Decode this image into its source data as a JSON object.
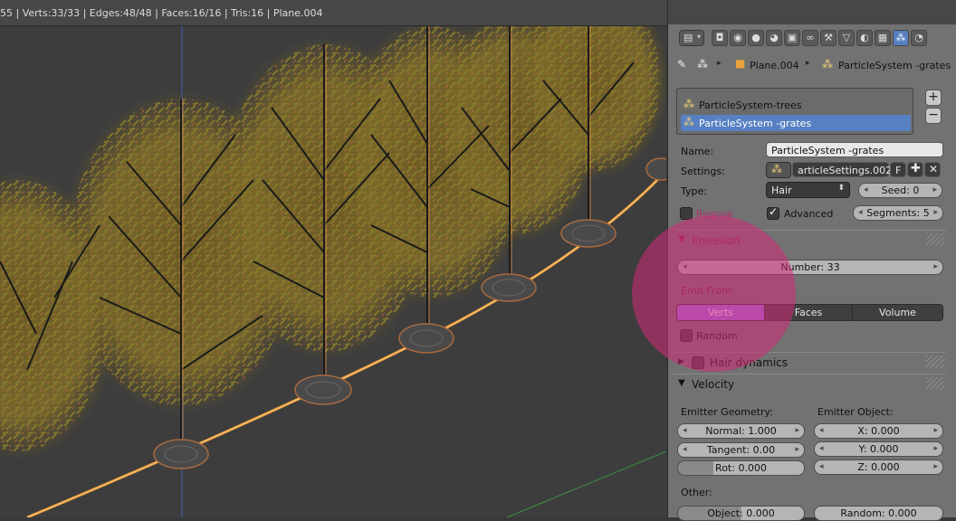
{
  "statusbar": {
    "text": "55 | Verts:33/33 | Edges:48/48 | Faces:16/16 | Tris:16 | Plane.004"
  },
  "properties": {
    "breadcrumb": {
      "object": "Plane.004",
      "particle": "ParticleSystem -grates"
    },
    "toolbar_icons": [
      "render-icon",
      "render-layers-icon",
      "scene-icon",
      "world-icon",
      "object-icon",
      "constraints-icon",
      "modifiers-icon",
      "data-icon",
      "material-icon",
      "texture-icon",
      "particles-icon",
      "physics-icon"
    ],
    "systems": [
      {
        "label": "ParticleSystem-trees",
        "selected": false
      },
      {
        "label": "ParticleSystem -grates",
        "selected": true
      }
    ],
    "name": {
      "label": "Name:",
      "value": "ParticleSystem -grates"
    },
    "settings": {
      "label": "Settings:",
      "value": "articleSettings.002",
      "fake_user": "F"
    },
    "type": {
      "label": "Type:",
      "value": "Hair"
    },
    "seed": {
      "value": "Seed: 0"
    },
    "regrow": {
      "label": "Regrow",
      "checked": false
    },
    "advanced": {
      "label": "Advanced",
      "checked": true
    },
    "segments": {
      "value": "Segments: 5"
    },
    "emission": {
      "title": "Emission",
      "number": "Number: 33",
      "emit_from_label": "Emit From:",
      "options": [
        "Verts",
        "Faces",
        "Volume"
      ],
      "selected": "Verts",
      "random": {
        "label": "Random",
        "checked": false
      }
    },
    "hair_dynamics": {
      "title": "Hair dynamics"
    },
    "velocity": {
      "title": "Velocity",
      "emitter_geometry_label": "Emitter Geometry:",
      "emitter_object_label": "Emitter Object:",
      "normal": "Normal: 1.000",
      "tangent": "Tangent: 0.00",
      "rot": "Rot: 0.000",
      "x": "X: 0.000",
      "y": "Y: 0.000",
      "z": "Z: 0.000",
      "other_label": "Other:",
      "object": "Object: 0.000",
      "random": "Random: 0.000"
    }
  },
  "colors": {
    "highlight": "#5680c2",
    "active_segment": "#9b6fe3",
    "overlay": "#d62a7a",
    "wire": "#f0a844"
  }
}
